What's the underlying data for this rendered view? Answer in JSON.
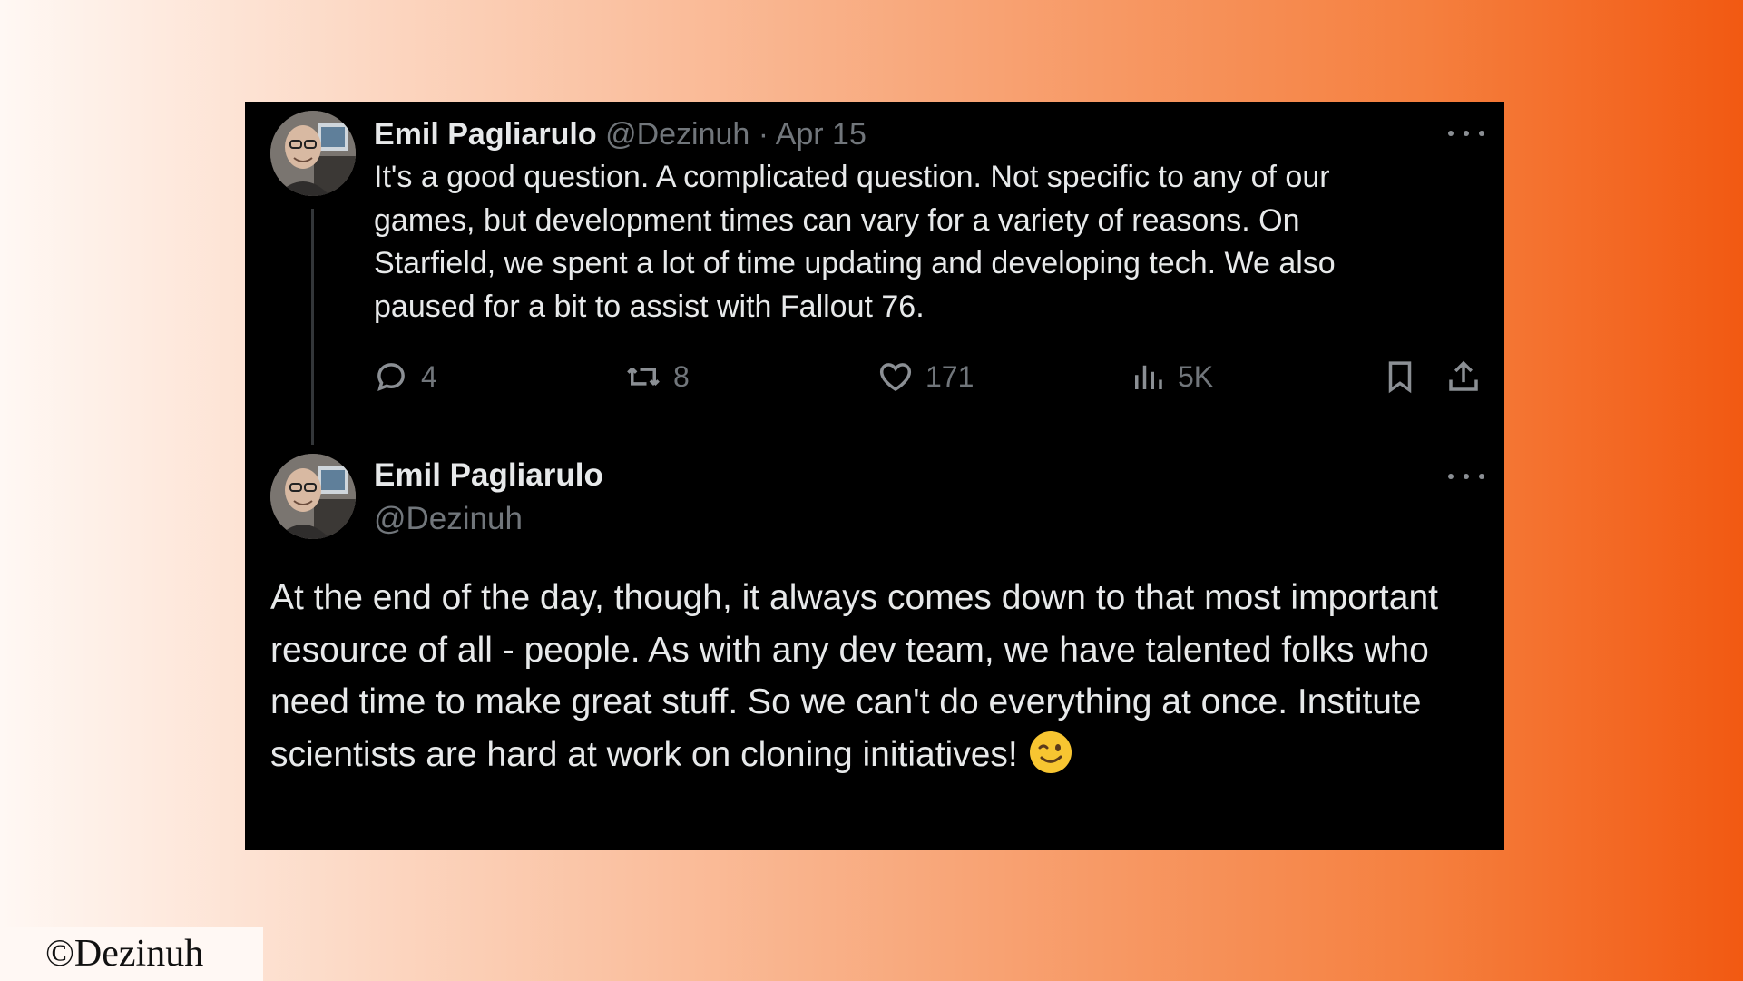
{
  "tweet1": {
    "name": "Emil Pagliarulo",
    "handle": "@Dezinuh",
    "separator": " · ",
    "date": "Apr 15",
    "text": "It's a good question. A complicated question. Not specific to any of our games, but development times can vary for a variety of reasons. On Starfield, we spent a lot of time updating and developing tech. We also paused for a bit to assist with Fallout 76.",
    "stats": {
      "replies": "4",
      "reposts": "8",
      "likes": "171",
      "views": "5K"
    }
  },
  "tweet2": {
    "name": "Emil Pagliarulo",
    "handle": "@Dezinuh",
    "text": "At the end of the day, though, it always comes down to that most important resource of all - people. As with any dev team, we have talented folks who need time to make great stuff. So we can't do everything at once. Institute scientists are hard at work on cloning initiatives!",
    "emoji": "winking-face"
  },
  "watermark": "©Dezinuh",
  "colors": {
    "card_bg": "#000000",
    "text": "#e7e9ea",
    "muted": "#71767b",
    "accent": "#f25912"
  }
}
